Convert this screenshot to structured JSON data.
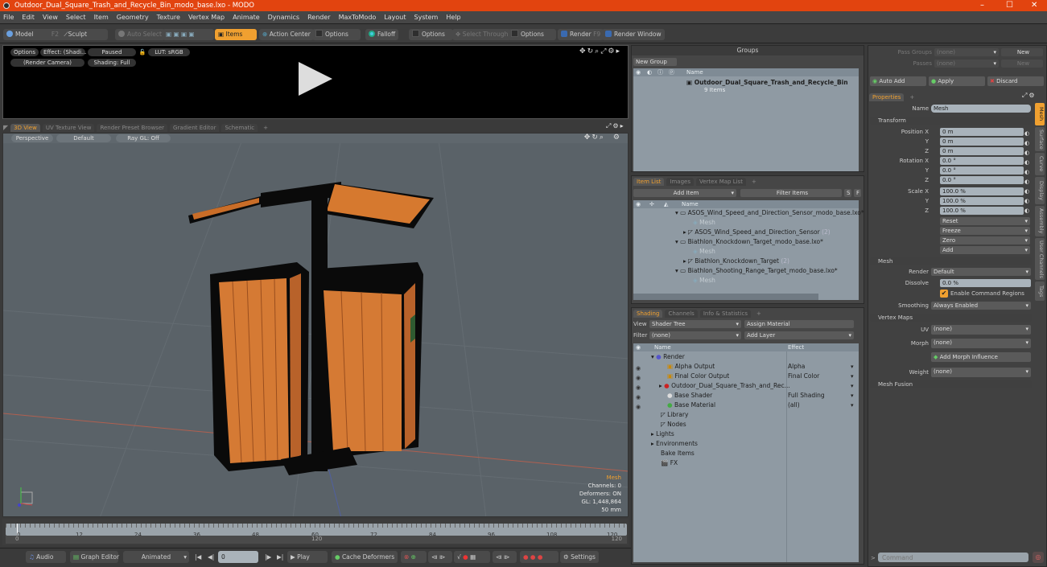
{
  "window": {
    "title": "Outdoor_Dual_Square_Trash_and_Recycle_Bin_modo_base.lxo - MODO",
    "minimize": "–",
    "maximize": "☐",
    "close": "✕"
  },
  "menu": [
    "File",
    "Edit",
    "View",
    "Select",
    "Item",
    "Geometry",
    "Texture",
    "Vertex Map",
    "Animate",
    "Dynamics",
    "Render",
    "MaxToModo",
    "Layout",
    "System",
    "Help"
  ],
  "toolbar": {
    "model": "Model",
    "model_key": "F2",
    "sculpt": "Sculpt",
    "auto_select": "Auto Select",
    "items": "Items",
    "action_center": "Action Center",
    "options1": "Options",
    "falloff": "Falloff",
    "options2": "Options",
    "select_through": "Select Through",
    "options3": "Options",
    "render": "Render",
    "render_key": "F9",
    "render_window": "Render Window"
  },
  "preview": {
    "options": "Options",
    "effect": "Effect: (Shadi...",
    "paused": "Paused",
    "lut": "LUT: sRGB",
    "camera": "(Render Camera)",
    "shading": "Shading: Full"
  },
  "viewport_tabs": [
    "3D View",
    "UV Texture View",
    "Render Preset Browser",
    "Gradient Editor",
    "Schematic",
    "+"
  ],
  "viewport": {
    "perspective": "Perspective",
    "default": "Default",
    "raygl": "Ray GL: Off",
    "hud": {
      "selection": "Mesh",
      "channels": "Channels: 0",
      "deformers": "Deformers: ON",
      "gl": "GL: 1,448,864",
      "focal": "50 mm"
    },
    "hud_color": "#f0a030"
  },
  "timeline": {
    "ticks": [
      "0",
      "12",
      "24",
      "36",
      "48",
      "60",
      "72",
      "84",
      "96",
      "108",
      "120"
    ],
    "range_start": "0",
    "range_mid": "120",
    "range_end": "120"
  },
  "bottombar": {
    "audio": "Audio",
    "graph_editor": "Graph Editor",
    "animated": "Animated",
    "frame": "0",
    "play": "Play",
    "cache_deformers": "Cache Deformers",
    "settings": "Settings"
  },
  "groups": {
    "title": "Groups",
    "new_group": "New Group",
    "col_name": "Name",
    "item_name": "Outdoor_Dual_Square_Trash_and_Recycle_Bin",
    "item_count": "9 Items"
  },
  "item_list": {
    "tabs": [
      "Item List",
      "Images",
      "Vertex Map List",
      "+"
    ],
    "add_item": "Add Item",
    "filter": "Filter Items",
    "s": "S",
    "f": "F",
    "col_name": "Name",
    "rows": [
      {
        "label": "ASOS_Wind_Speed_and_Direction_Sensor_modo_base.lxo*",
        "indent": 0,
        "type": "scene"
      },
      {
        "label": "Mesh",
        "indent": 1,
        "type": "mesh-ghost"
      },
      {
        "label": "ASOS_Wind_Speed_and_Direction_Sensor",
        "count": "(2)",
        "indent": 1,
        "type": "group"
      },
      {
        "label": "Biathlon_Knockdown_Target_modo_base.lxo*",
        "indent": 0,
        "type": "scene"
      },
      {
        "label": "Mesh",
        "indent": 1,
        "type": "mesh-ghost"
      },
      {
        "label": "Biathlon_Knockdown_Target",
        "count": "(2)",
        "indent": 1,
        "type": "group"
      },
      {
        "label": "Biathlon_Shooting_Range_Target_modo_base.lxo*",
        "indent": 0,
        "type": "scene"
      },
      {
        "label": "Mesh",
        "indent": 1,
        "type": "mesh-ghost"
      }
    ]
  },
  "shading": {
    "tabs": [
      "Shading",
      "Channels",
      "Info & Statistics",
      "+"
    ],
    "view_label": "View",
    "view_value": "Shader Tree",
    "assign_material": "Assign Material",
    "filter_label": "Filter",
    "filter_value": "(none)",
    "add_layer": "Add Layer",
    "col_name": "Name",
    "col_effect": "Effect",
    "rows": [
      {
        "name": "Render",
        "effect": "",
        "indent": 0
      },
      {
        "name": "Alpha Output",
        "effect": "Alpha",
        "indent": 1
      },
      {
        "name": "Final Color Output",
        "effect": "Final Color",
        "indent": 1
      },
      {
        "name": "Outdoor_Dual_Square_Trash_and_Rec...",
        "effect": "",
        "indent": 1
      },
      {
        "name": "Base Shader",
        "effect": "Full Shading",
        "indent": 1
      },
      {
        "name": "Base Material",
        "effect": "(all)",
        "indent": 1
      },
      {
        "name": "Library",
        "effect": "",
        "indent": 0
      },
      {
        "name": "Nodes",
        "effect": "",
        "indent": 0
      },
      {
        "name": "Lights",
        "effect": "",
        "indent": -1
      },
      {
        "name": "Environments",
        "effect": "",
        "indent": -1
      },
      {
        "name": "Bake Items",
        "effect": "",
        "indent": -1
      },
      {
        "name": "FX",
        "effect": "",
        "indent": -1
      }
    ]
  },
  "passes": {
    "pass_groups": "Pass Groups",
    "passes": "Passes",
    "none": "(none)",
    "new": "New",
    "auto_add": "Auto Add",
    "apply": "Apply",
    "discard": "Discard"
  },
  "properties": {
    "tab": "Properties",
    "plus": "+",
    "name_label": "Name",
    "name_value": "Mesh",
    "transform": "Transform",
    "position": {
      "label": "Position X",
      "x": "0 m",
      "y": "0 m",
      "z": "0 m"
    },
    "rotation": {
      "label": "Rotation X",
      "x": "0.0 °",
      "y": "0.0 °",
      "z": "0.0 °"
    },
    "scale": {
      "label": "Scale X",
      "x": "100.0 %",
      "y": "100.0 %",
      "z": "100.0 %"
    },
    "y": "Y",
    "z": "Z",
    "actions": [
      "Reset",
      "Freeze",
      "Zero",
      "Add"
    ],
    "mesh": "Mesh",
    "render_label": "Render",
    "render_value": "Default",
    "dissolve_label": "Dissolve",
    "dissolve_value": "0.0 %",
    "enable_command_regions": "Enable Command Regions",
    "smoothing_label": "Smoothing",
    "smoothing_value": "Always Enabled",
    "vertex_maps": "Vertex Maps",
    "uv_label": "UV",
    "uv_value": "(none)",
    "morph_label": "Morph",
    "morph_value": "(none)",
    "add_morph": "Add Morph Influence",
    "weight_label": "Weight",
    "weight_value": "(none)",
    "mesh_fusion": "Mesh Fusion",
    "side_tabs": [
      "Mesh",
      "Surface",
      "Curve",
      "Display",
      "Assembly",
      "User Channels",
      "Tags"
    ]
  },
  "command": {
    "prompt": ">",
    "placeholder": "Command"
  },
  "colors": {
    "accent": "#f0a030",
    "title_bar": "#e2440f",
    "wood": "#d9782c",
    "frame": "#0a0a0a"
  }
}
